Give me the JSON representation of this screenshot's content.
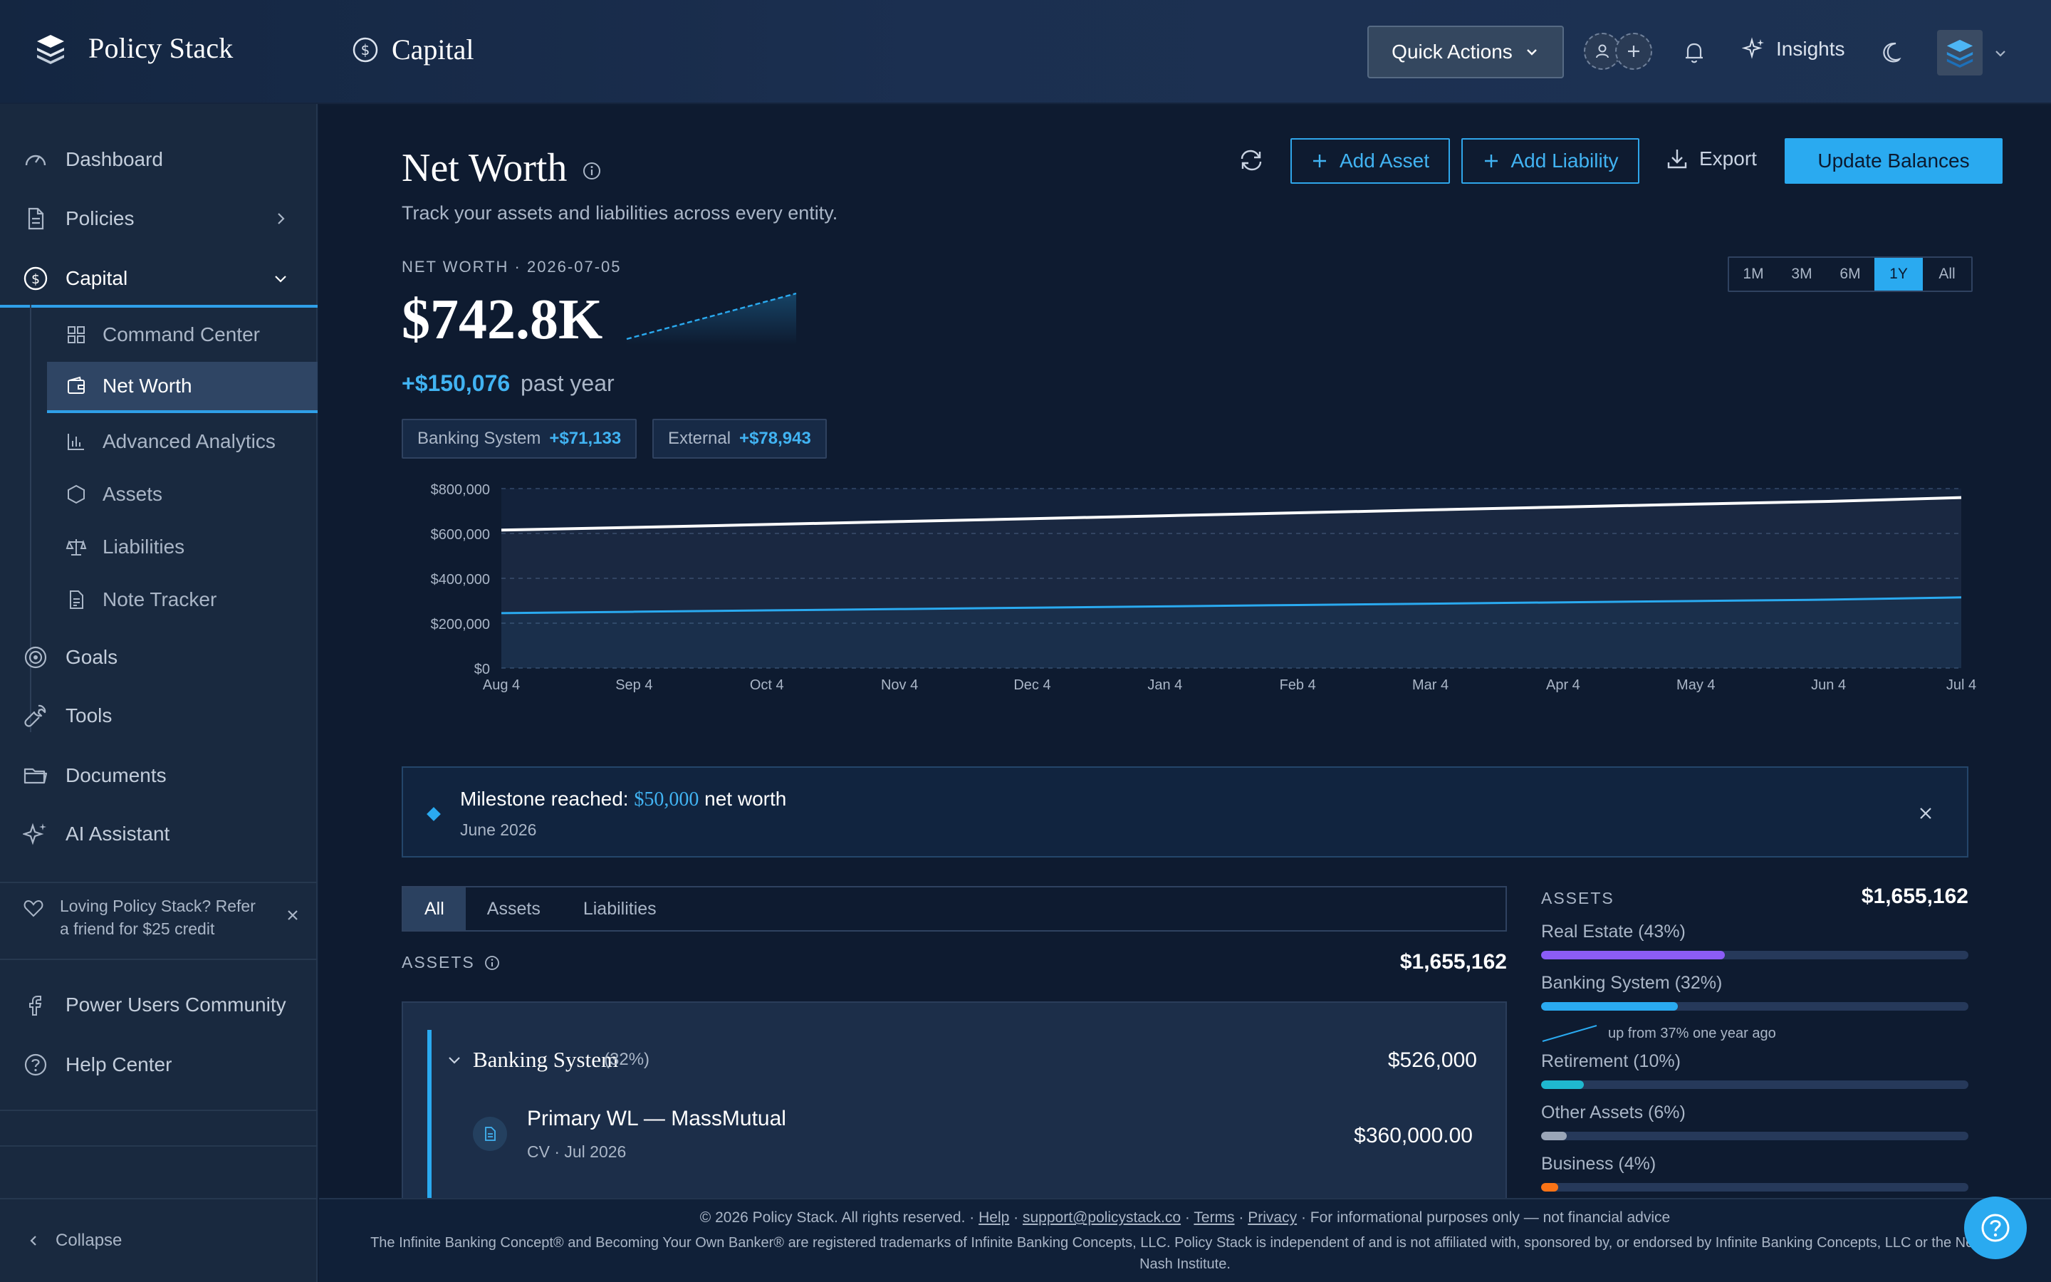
{
  "header": {
    "brand": "Policy Stack",
    "section": "Capital",
    "quick_actions": "Quick Actions",
    "insights": "Insights"
  },
  "sidebar": {
    "items": [
      {
        "label": "Dashboard"
      },
      {
        "label": "Policies"
      },
      {
        "label": "Capital"
      },
      {
        "label": "Goals"
      },
      {
        "label": "Tools"
      },
      {
        "label": "Documents"
      },
      {
        "label": "AI Assistant"
      }
    ],
    "capital_sub": [
      {
        "label": "Command Center"
      },
      {
        "label": "Net Worth"
      },
      {
        "label": "Advanced Analytics"
      },
      {
        "label": "Assets"
      },
      {
        "label": "Liabilities"
      },
      {
        "label": "Note Tracker"
      }
    ],
    "refer_line1": "Loving Policy Stack? Refer",
    "refer_line2": "a friend for $25 credit",
    "community": "Power Users Community",
    "help_center": "Help Center",
    "collapse": "Collapse"
  },
  "page": {
    "title": "Net Worth",
    "subtitle": "Track your assets and liabilities across every entity.",
    "add_asset": "Add Asset",
    "add_liability": "Add Liability",
    "export": "Export",
    "update_balances": "Update Balances",
    "nw_label": "NET WORTH · 2026-07-05",
    "nw_value": "$742.8K",
    "change_amount": "+$150,076",
    "change_period": "past year",
    "chips": [
      {
        "label": "Banking System",
        "value": "+$71,133"
      },
      {
        "label": "External",
        "value": "+$78,943"
      }
    ],
    "ranges": [
      "1M",
      "3M",
      "6M",
      "1Y",
      "All"
    ],
    "active_range": "1Y"
  },
  "chart_data": {
    "type": "line",
    "x": [
      "Aug 4",
      "Sep 4",
      "Oct 4",
      "Nov 4",
      "Dec 4",
      "Jan 4",
      "Feb 4",
      "Mar 4",
      "Apr 4",
      "May 4",
      "Jun 4",
      "Jul 4"
    ],
    "y_ticks": [
      "$0",
      "$200,000",
      "$400,000",
      "$600,000",
      "$800,000"
    ],
    "ylim": [
      0,
      800000
    ],
    "grid": true,
    "series": [
      {
        "color": "#ffffff",
        "values": [
          615000,
          627000,
          640000,
          653000,
          666000,
          679000,
          692000,
          705000,
          718000,
          731000,
          743000,
          760000
        ]
      },
      {
        "color": "#2aaaf0",
        "values": [
          245000,
          251000,
          257000,
          263000,
          269000,
          275000,
          281000,
          287000,
          293000,
          299000,
          305000,
          315000
        ]
      }
    ]
  },
  "milestone": {
    "prefix": "Milestone reached:",
    "amount": "$50,000",
    "suffix": "net worth",
    "date": "June 2026"
  },
  "tabs": [
    "All",
    "Assets",
    "Liabilities"
  ],
  "assets_section": {
    "label": "ASSETS",
    "total": "$1,655,162",
    "group": {
      "name": "Banking System",
      "pct": "(32%)",
      "value": "$526,000",
      "policy_name": "Primary WL — MassMutual",
      "policy_meta": "CV · Jul 2026",
      "policy_value": "$360,000.00"
    }
  },
  "allocation": {
    "label": "ASSETS",
    "total": "$1,655,162",
    "rows": [
      {
        "label": "Real Estate (43%)",
        "pct": 43,
        "color": "#8b5cf6"
      },
      {
        "label": "Banking System (32%)",
        "pct": 32,
        "color": "#2aaaf0"
      },
      {
        "label": "Retirement (10%)",
        "pct": 10,
        "color": "#1fb8cf"
      },
      {
        "label": "Other Assets (6%)",
        "pct": 6,
        "color": "#9aa6b8"
      },
      {
        "label": "Business (4%)",
        "pct": 4,
        "color": "#f97316"
      }
    ],
    "note": "up from 37% one year ago"
  },
  "footer": {
    "copyright": "© 2026 Policy Stack. All rights reserved. ·",
    "help": "Help",
    "sep1": "·",
    "email": "support@policystack.co",
    "sep2": "·",
    "terms": "Terms",
    "sep3": "·",
    "privacy": "Privacy",
    "disclaimer": "· For informational purposes only — not financial advice",
    "trademark": "The Infinite Banking Concept® and Becoming Your Own Banker® are registered trademarks of Infinite Banking Concepts, LLC. Policy Stack is independent of and is not affiliated with, sponsored by, or endorsed by Infinite Banking Concepts, LLC or the Nelson Nash Institute."
  }
}
